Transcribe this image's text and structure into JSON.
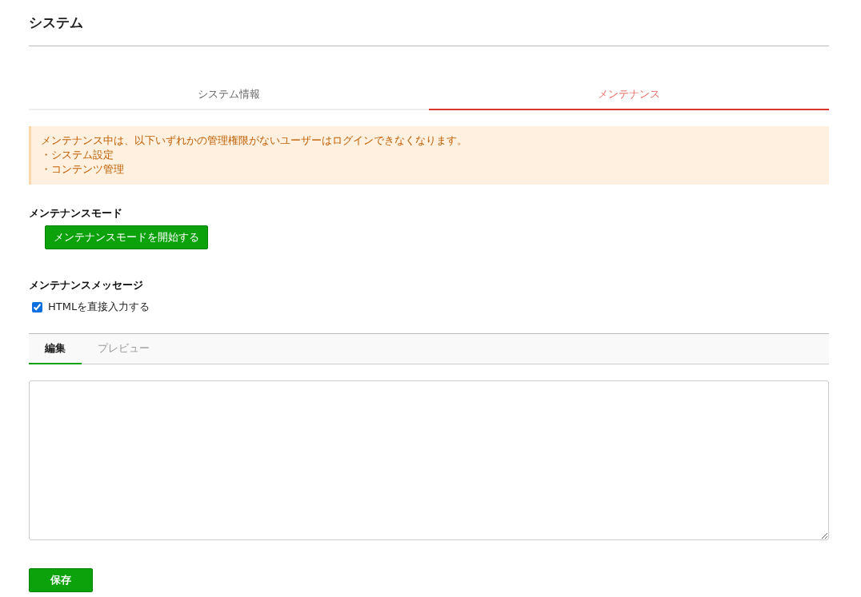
{
  "page": {
    "title": "システム"
  },
  "tabs": [
    {
      "label": "システム情報",
      "selected": false
    },
    {
      "label": "メンテナンス",
      "selected": true
    }
  ],
  "notice": {
    "message": "メンテナンス中は、以下いずれかの管理権限がないユーザーはログインできなくなります。",
    "items": [
      "・システム設定",
      "・コンテンツ管理"
    ]
  },
  "maintenance_mode": {
    "label": "メンテナンスモード",
    "button": "メンテナンスモードを開始する"
  },
  "maintenance_message": {
    "label": "メンテナンスメッセージ",
    "html_checkbox": {
      "label": "HTMLを直接入力する",
      "checked": true
    },
    "editor_tabs": [
      {
        "label": "編集",
        "selected": true
      },
      {
        "label": "プレビュー",
        "selected": false
      }
    ]
  },
  "save_button": "保存"
}
